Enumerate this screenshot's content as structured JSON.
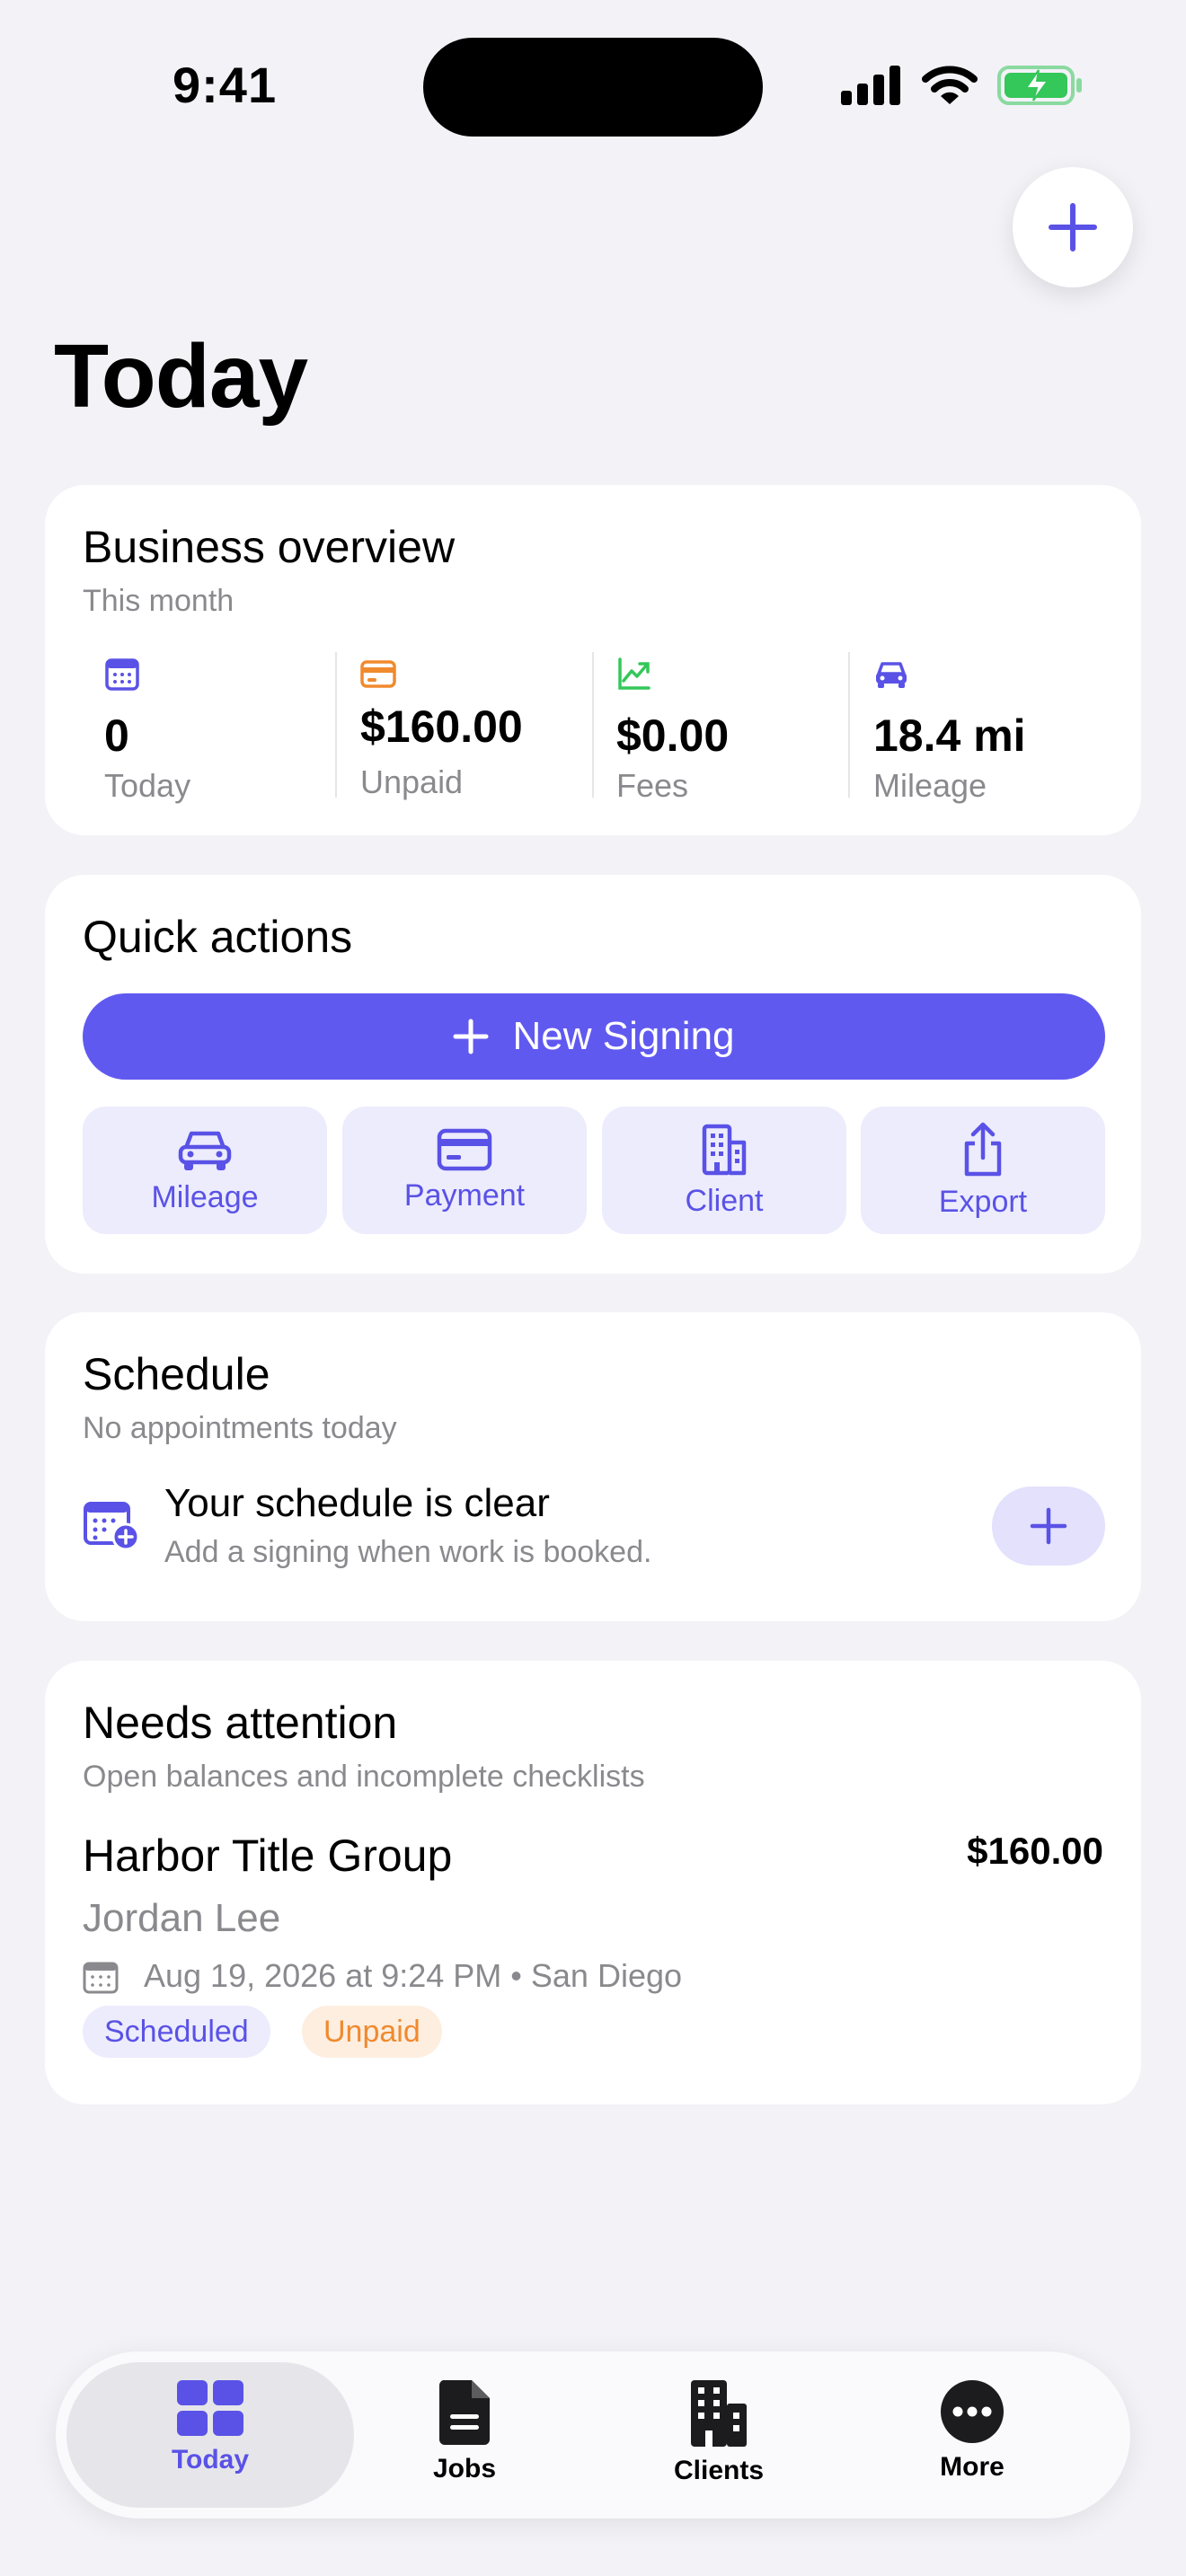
{
  "status_bar": {
    "time": "9:41"
  },
  "page": {
    "title": "Today"
  },
  "overview": {
    "title": "Business overview",
    "subtitle": "This month",
    "metrics": [
      {
        "icon": "calendar-icon",
        "value": "0",
        "label": "Today",
        "color": "#5a52e6"
      },
      {
        "icon": "credit-card-icon",
        "value": "$160.00",
        "label": "Unpaid",
        "color": "#f08a2e"
      },
      {
        "icon": "trend-up-icon",
        "value": "$0.00",
        "label": "Fees",
        "color": "#34c759"
      },
      {
        "icon": "car-icon",
        "value": "18.4 mi",
        "label": "Mileage",
        "color": "#5a52e6"
      }
    ]
  },
  "quick_actions": {
    "title": "Quick actions",
    "primary_label": "New Signing",
    "buttons": [
      {
        "icon": "car-icon",
        "label": "Mileage"
      },
      {
        "icon": "credit-card-icon",
        "label": "Payment"
      },
      {
        "icon": "building-icon",
        "label": "Client"
      },
      {
        "icon": "share-icon",
        "label": "Export"
      }
    ]
  },
  "schedule": {
    "title": "Schedule",
    "subtitle": "No appointments today",
    "empty_title": "Your schedule is clear",
    "empty_subtitle": "Add a signing when work is booked."
  },
  "attention": {
    "title": "Needs attention",
    "subtitle": "Open balances and incomplete checklists",
    "item": {
      "client": "Harbor Title Group",
      "amount": "$160.00",
      "contact": "Jordan Lee",
      "when": "Aug 19, 2026 at 9:24 PM • San Diego",
      "badges": [
        {
          "label": "Scheduled",
          "color": "#5a52e6",
          "bg": "#ececfd"
        },
        {
          "label": "Unpaid",
          "color": "#f08a2e",
          "bg": "#fdeee0"
        }
      ]
    }
  },
  "tabs": [
    {
      "label": "Today",
      "icon": "grid-icon",
      "active": true
    },
    {
      "label": "Jobs",
      "icon": "document-icon",
      "active": false
    },
    {
      "label": "Clients",
      "icon": "building-icon",
      "active": false
    },
    {
      "label": "More",
      "icon": "more-icon",
      "active": false
    }
  ],
  "colors": {
    "accent": "#6059f0",
    "background": "#f2f2f7"
  }
}
